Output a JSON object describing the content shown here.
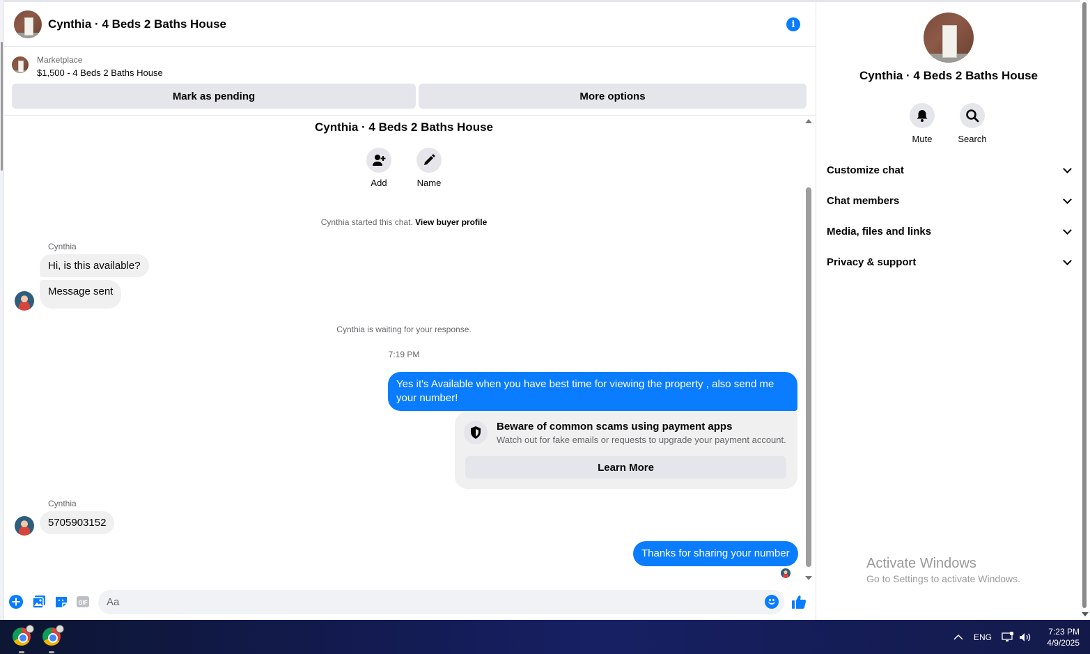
{
  "header": {
    "title": "Cynthia · 4 Beds 2 Baths House"
  },
  "marketplace": {
    "label": "Marketplace",
    "listing": "$1,500 - 4 Beds 2 Baths House",
    "mark_pending_label": "Mark as pending",
    "more_options_label": "More options"
  },
  "conversation": {
    "title": "Cynthia · 4 Beds 2 Baths House",
    "add_label": "Add",
    "name_label": "Name",
    "started_text": "Cynthia started this chat.",
    "view_profile_link": "View buyer profile",
    "waiting_text": "Cynthia is waiting for your response.",
    "timestamp": "7:19 PM"
  },
  "messages": [
    {
      "sender": "Cynthia",
      "text": "Hi, is this available?"
    },
    {
      "sender": "Cynthia",
      "text": "Message sent"
    },
    {
      "sender": "me",
      "text": "Yes it's Available when you have best time for viewing the property , also send me your number!"
    },
    {
      "sender": "Cynthia",
      "text": "5705903152"
    },
    {
      "sender": "me",
      "text": "Thanks for sharing your number"
    }
  ],
  "scam_warning": {
    "title": "Beware of common scams using payment apps",
    "description": "Watch out for fake emails or requests to upgrade your payment account.",
    "button_label": "Learn More"
  },
  "composer": {
    "placeholder": "Aa"
  },
  "right_panel": {
    "title": "Cynthia · 4 Beds 2 Baths House",
    "mute_label": "Mute",
    "search_label": "Search",
    "sections": [
      "Customize chat",
      "Chat members",
      "Media, files and links",
      "Privacy & support"
    ]
  },
  "watermark": {
    "line1": "Activate Windows",
    "line2": "Go to Settings to activate Windows."
  },
  "taskbar": {
    "language": "ENG",
    "time": "7:23 PM",
    "date": "4/9/2025"
  },
  "colors": {
    "accent": "#0a7cff",
    "bubble_in": "#f0f0f0",
    "button_bg": "#e4e6eb"
  },
  "icons": [
    "info-icon",
    "add-person-icon",
    "pencil-icon",
    "shield-icon",
    "bell-icon",
    "search-icon",
    "plus-icon",
    "photo-icon",
    "sticker-icon",
    "gif-icon",
    "emoji-icon",
    "thumbs-up-icon",
    "chevron-down-icon"
  ]
}
